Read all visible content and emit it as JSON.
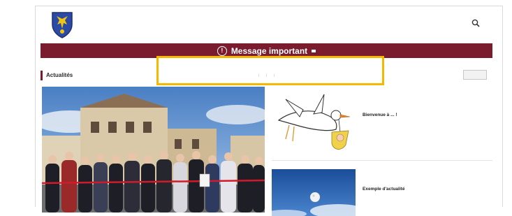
{
  "colors": {
    "banner": "#7a1c2e",
    "highlight": "#f5b800",
    "crest_blue": "#2b4aa6",
    "crest_gold": "#f1c40f"
  },
  "header": {
    "logo_icon": "municipal-crest",
    "nav": [
      "",
      "",
      "",
      ""
    ],
    "search_icon": "search-icon"
  },
  "banner": {
    "icon": "exclamation-circle-icon",
    "message": "Message important",
    "more_label": ""
  },
  "news": {
    "title": "Actualités",
    "filters": [
      "",
      "",
      "",
      ""
    ],
    "all_label": ""
  },
  "articles": [
    {
      "category": "",
      "title": "Bienvenue à ... !",
      "excerpt": "",
      "date": "",
      "image": "stork-carrying-baby-illustration"
    },
    {
      "category": "",
      "title": "Exemple d'actualité",
      "excerpt": "",
      "image": "moon-blue-sky-photo"
    }
  ],
  "featured": {
    "image": "ribbon-cutting-ceremony-photo"
  }
}
